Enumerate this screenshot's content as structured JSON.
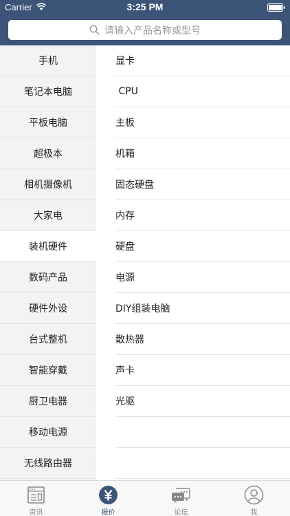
{
  "status_bar": {
    "carrier": "Carrier",
    "time": "3:25 PM"
  },
  "search": {
    "placeholder": "请输入产品名称或型号"
  },
  "categories": [
    {
      "label": "手机"
    },
    {
      "label": "笔记本电脑"
    },
    {
      "label": "平板电脑"
    },
    {
      "label": "超极本"
    },
    {
      "label": "相机摄像机"
    },
    {
      "label": "大家电"
    },
    {
      "label": "装机硬件",
      "active": true
    },
    {
      "label": "数码产品"
    },
    {
      "label": "硬件外设"
    },
    {
      "label": "台式整机"
    },
    {
      "label": "智能穿戴"
    },
    {
      "label": "厨卫电器"
    },
    {
      "label": "移动电源"
    },
    {
      "label": "无线路由器"
    }
  ],
  "subcategories": [
    {
      "label": "显卡"
    },
    {
      "label": " CPU"
    },
    {
      "label": "主板"
    },
    {
      "label": "机箱"
    },
    {
      "label": "固态硬盘"
    },
    {
      "label": "内存"
    },
    {
      "label": "硬盘"
    },
    {
      "label": "电源"
    },
    {
      "label": "DIY组装电脑"
    },
    {
      "label": "散热器"
    },
    {
      "label": "声卡"
    },
    {
      "label": "光驱"
    },
    {
      "label": ""
    },
    {
      "label": ""
    }
  ],
  "tabbar": {
    "tabs": [
      {
        "label": "资讯",
        "icon": "news-icon"
      },
      {
        "label": "报价",
        "icon": "yen-icon",
        "active": true
      },
      {
        "label": "论坛",
        "icon": "chat-bubble-icon"
      },
      {
        "label": "我",
        "icon": "user-icon"
      }
    ]
  },
  "colors": {
    "header": "#3b5477",
    "active_tab": "#3b5477",
    "inactive_tab": "#8a8a8a",
    "sidebar_bg": "#f3f3f3"
  }
}
